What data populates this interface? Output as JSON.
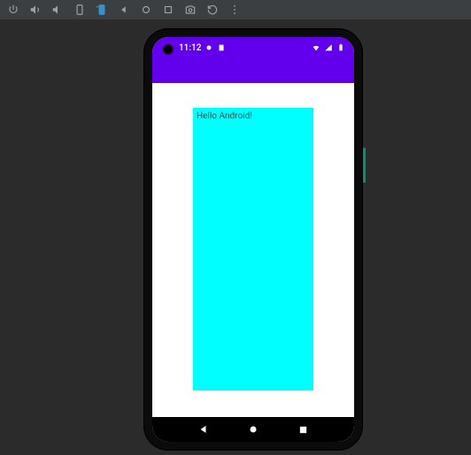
{
  "status": {
    "time": "11:12"
  },
  "app": {
    "greeting": "Hello Android!"
  }
}
